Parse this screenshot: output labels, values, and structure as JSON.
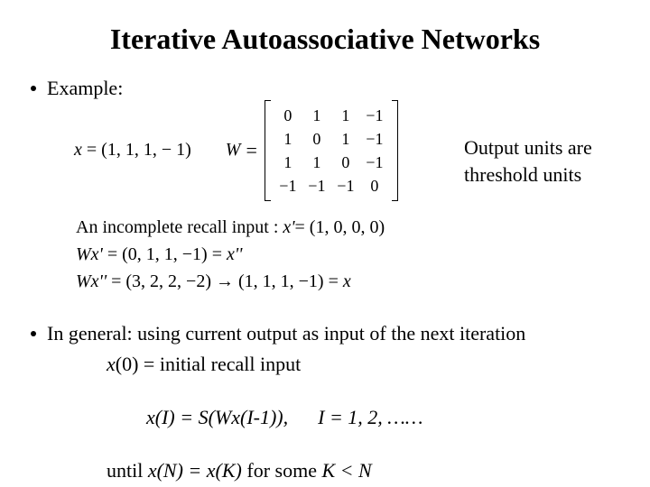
{
  "title": "Iterative Autoassociative Networks",
  "bullet_example": "Example:",
  "x_vector_label": "x",
  "x_vector": "= (1, 1, 1, − 1)",
  "W_label": "W",
  "W_eq": "=",
  "W_matrix": {
    "rows": [
      [
        "0",
        "1",
        "1",
        "−1"
      ],
      [
        "1",
        "0",
        "1",
        "−1"
      ],
      [
        "1",
        "1",
        "0",
        "−1"
      ],
      [
        "−1",
        "−1",
        "−1",
        "0"
      ]
    ]
  },
  "side_note_l1": "Output units are",
  "side_note_l2": "threshold units",
  "recall": {
    "l1_prefix": "An incomplete recall input : ",
    "l1_var": "x'",
    "l1_rest": "= (1, 0, 0, 0)",
    "l2_a": "Wx'",
    "l2_b": " = (0, 1, 1, −1) = ",
    "l2_c": "x''",
    "l3_a": "Wx''",
    "l3_b": " = (3, 2, 2, −2) → (1, 1, 1, −1) = ",
    "l3_c": "x"
  },
  "bullet_general": "In general: using current output as input of the next iteration",
  "sub": {
    "l1_a": "x",
    "l1_b": "(0) = initial recall input",
    "l2": "x(I) = S(Wx(I-1)),      I = 1, 2, ……",
    "l3_a": "until ",
    "l3_b": "x(N) = x(K)",
    "l3_c": "  for some ",
    "l3_d": "K < N"
  }
}
